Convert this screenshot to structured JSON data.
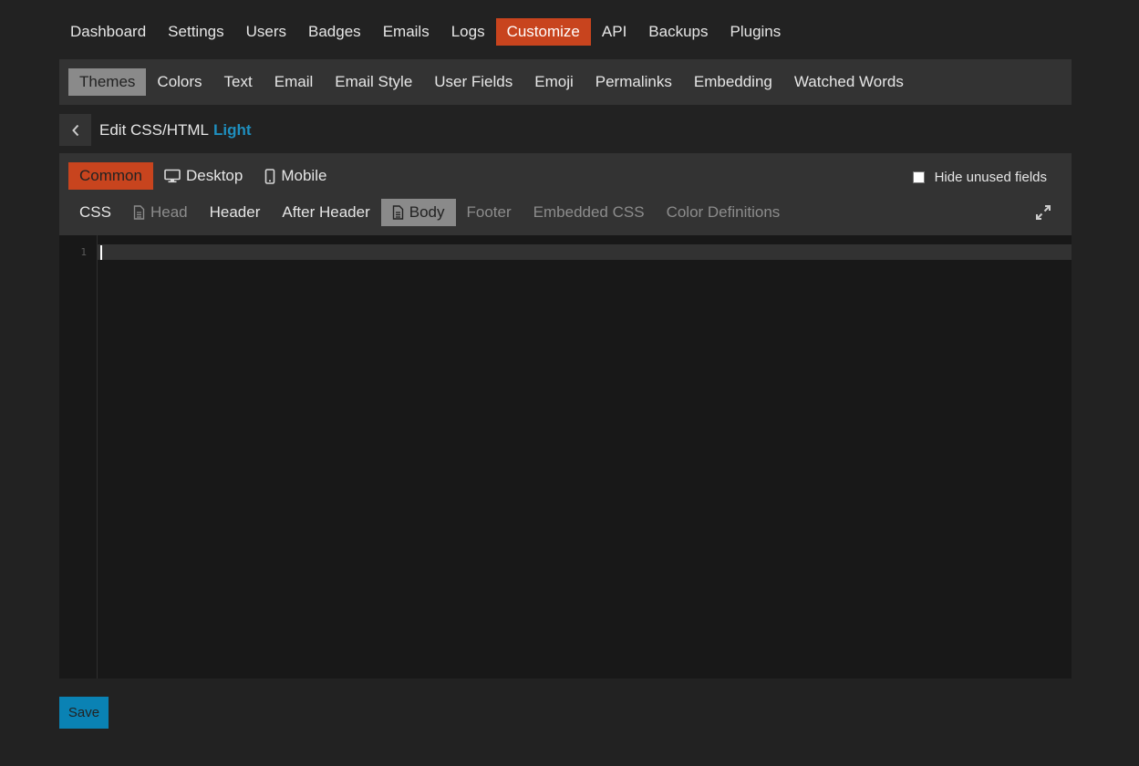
{
  "top_nav": {
    "items": [
      {
        "label": "Dashboard"
      },
      {
        "label": "Settings"
      },
      {
        "label": "Users"
      },
      {
        "label": "Badges"
      },
      {
        "label": "Emails"
      },
      {
        "label": "Logs"
      },
      {
        "label": "Customize",
        "active": true
      },
      {
        "label": "API"
      },
      {
        "label": "Backups"
      },
      {
        "label": "Plugins"
      }
    ]
  },
  "sub_nav": {
    "items": [
      {
        "label": "Themes",
        "active": true
      },
      {
        "label": "Colors"
      },
      {
        "label": "Text"
      },
      {
        "label": "Email"
      },
      {
        "label": "Email Style"
      },
      {
        "label": "User Fields"
      },
      {
        "label": "Emoji"
      },
      {
        "label": "Permalinks"
      },
      {
        "label": "Embedding"
      },
      {
        "label": "Watched Words"
      }
    ]
  },
  "edit_header": {
    "back_icon": "chevron-left-icon",
    "title": "Edit CSS/HTML",
    "theme_name": "Light",
    "theme_color": "#1f8fbf"
  },
  "target_tabs": [
    {
      "label": "Common",
      "active": true
    },
    {
      "label": "Desktop",
      "icon": "desktop-icon"
    },
    {
      "label": "Mobile",
      "icon": "mobile-icon"
    }
  ],
  "hide_unused": {
    "label": "Hide unused fields",
    "checked": false
  },
  "field_tabs": [
    {
      "label": "CSS"
    },
    {
      "label": "Head",
      "icon": "file-icon",
      "muted": true
    },
    {
      "label": "Header"
    },
    {
      "label": "After Header"
    },
    {
      "label": "Body",
      "icon": "file-icon",
      "active": true
    },
    {
      "label": "Footer",
      "muted": true
    },
    {
      "label": "Embedded CSS",
      "muted": true
    },
    {
      "label": "Color Definitions",
      "muted": true
    }
  ],
  "editor": {
    "line_numbers": [
      "1"
    ],
    "content": ""
  },
  "save_button": {
    "label": "Save"
  },
  "colors": {
    "accent": "#c8441e",
    "primary_button": "#0a82b4",
    "background": "#222222",
    "panel": "#333333"
  }
}
